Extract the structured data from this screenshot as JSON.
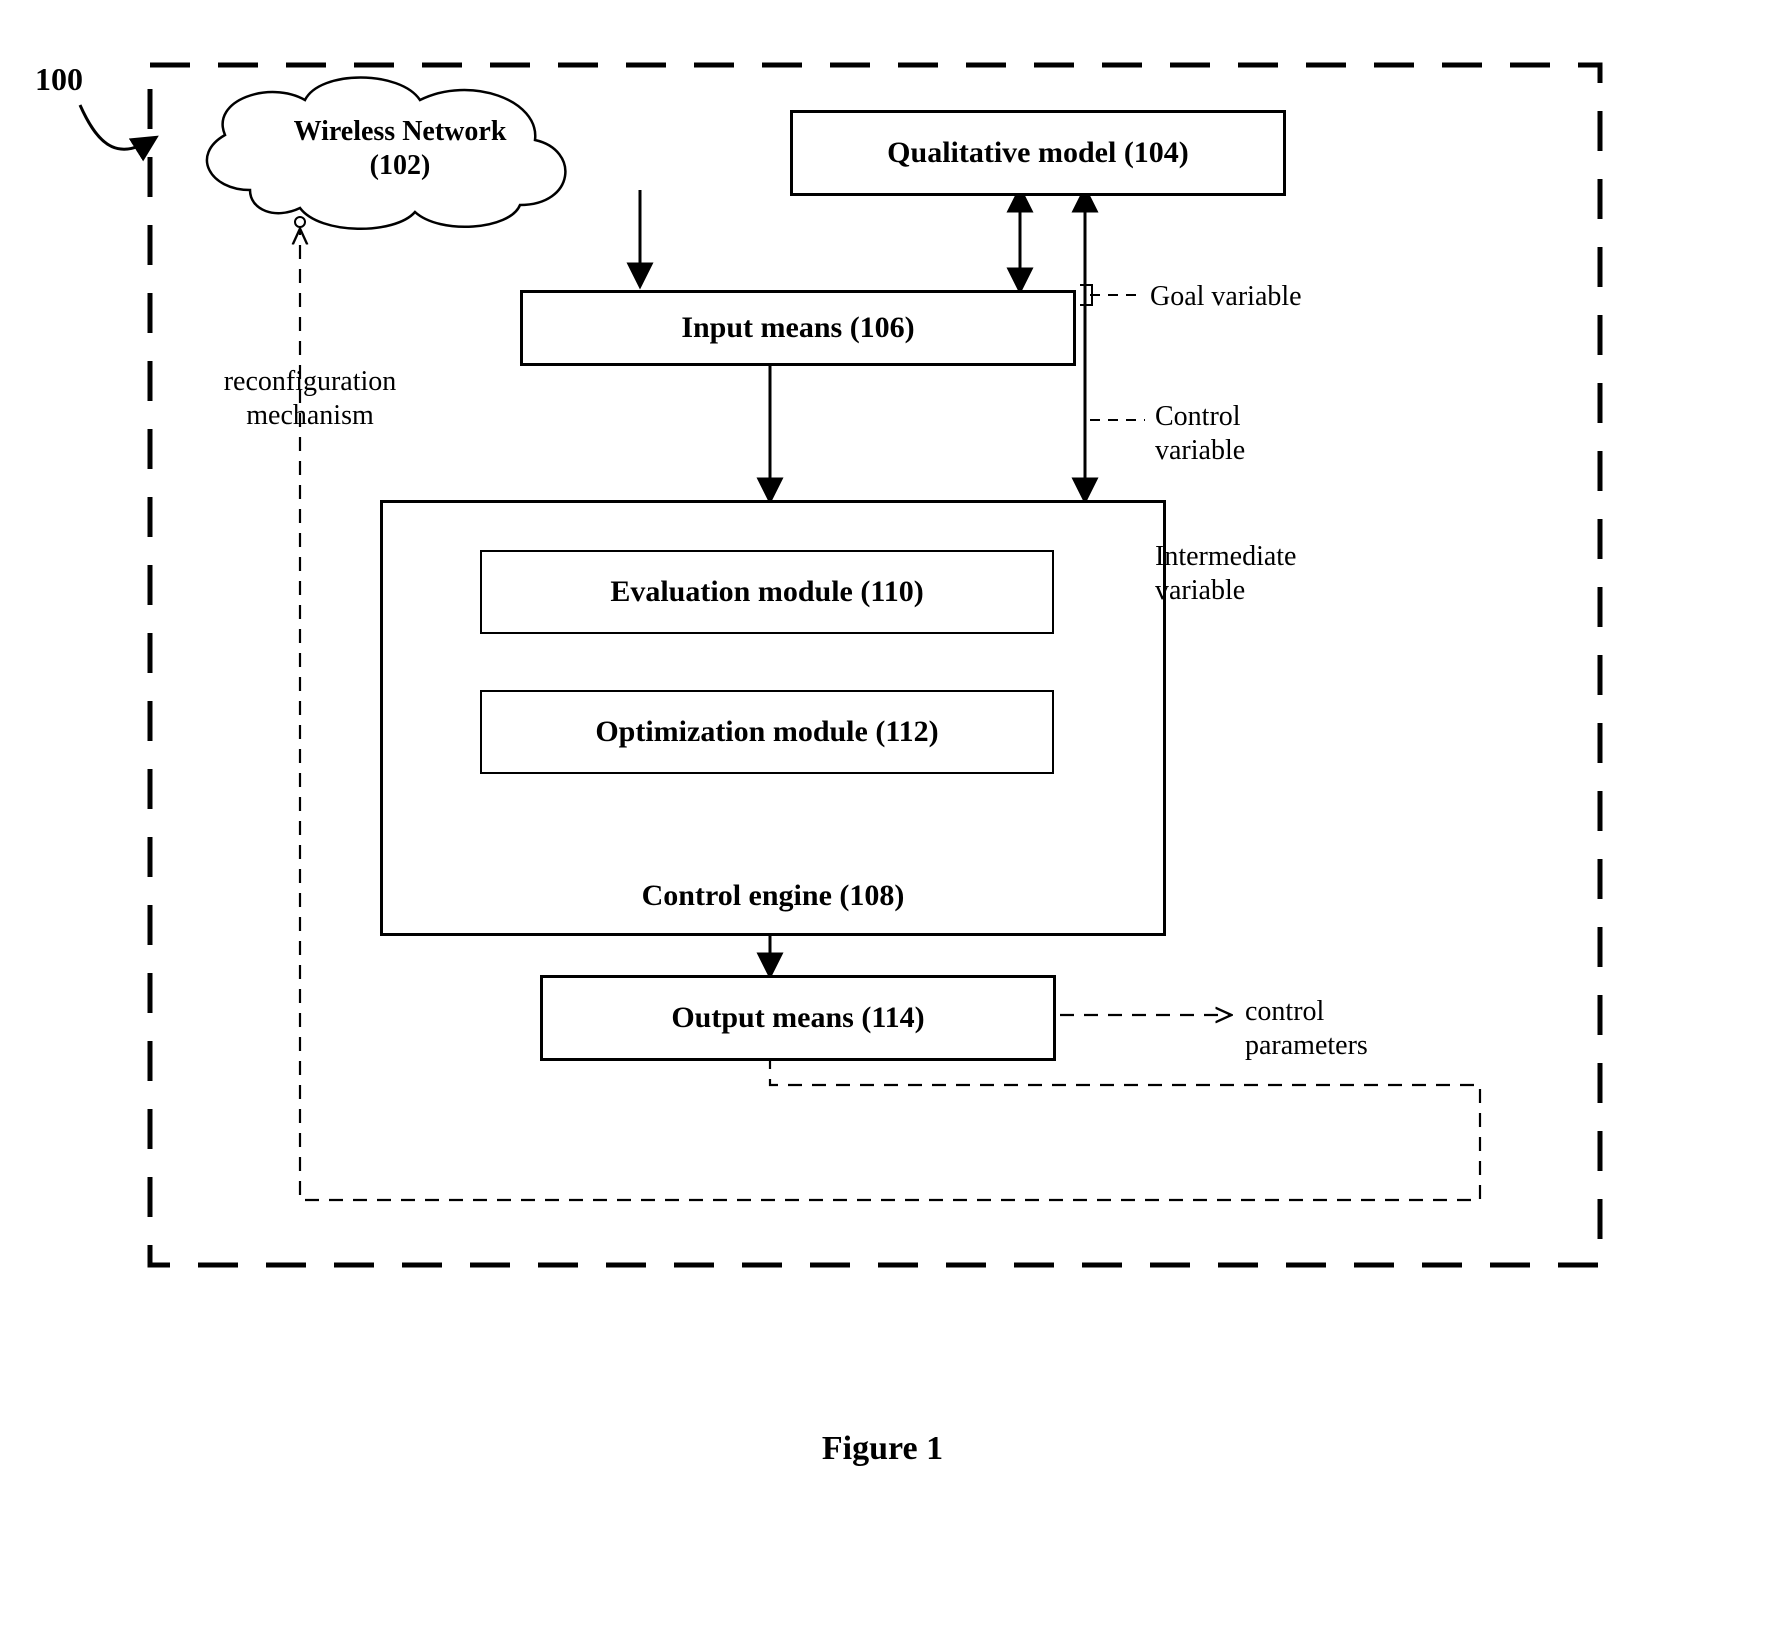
{
  "diagram": {
    "id_label": "100",
    "caption": "Figure 1",
    "cloud": {
      "line1": "Wireless Network",
      "line2": "(102)"
    },
    "qualitative_model": {
      "label": "Qualitative model (104)"
    },
    "input_means": {
      "label": "Input means (106)"
    },
    "control_engine": {
      "label": "Control engine (108)",
      "evaluation": "Evaluation module (110)",
      "optimization": "Optimization module (112)"
    },
    "output_means": {
      "label": "Output means (114)"
    },
    "annotations": {
      "reconfiguration": "reconfiguration\nmechanism",
      "goal_variable": "Goal variable",
      "control_variable": "Control\nvariable",
      "intermediate_variable": "Intermediate\nvariable",
      "control_parameters": "control\nparameters"
    }
  }
}
